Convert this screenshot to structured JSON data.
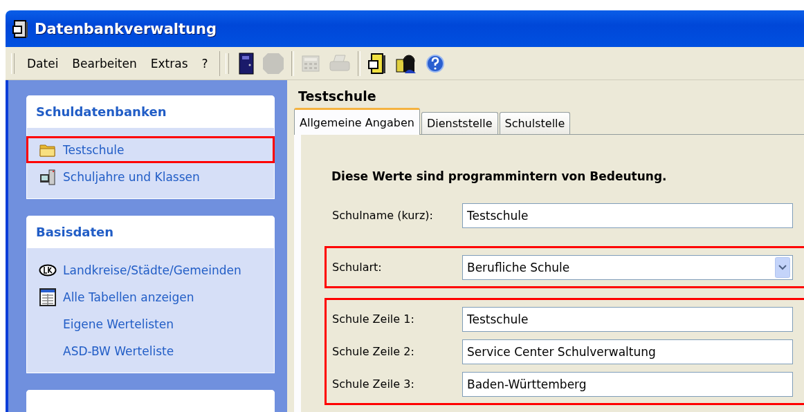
{
  "window": {
    "title": "Datenbankverwaltung"
  },
  "menu": [
    {
      "label": "Datei"
    },
    {
      "label": "Bearbeiten"
    },
    {
      "label": "Extras"
    },
    {
      "label": "?"
    }
  ],
  "toolbar": [
    {
      "kind": "door",
      "disabled": false
    },
    {
      "kind": "stop",
      "disabled": true
    },
    {
      "kind": "sep"
    },
    {
      "kind": "calculator",
      "disabled": true
    },
    {
      "kind": "printer",
      "disabled": true
    },
    {
      "kind": "sep"
    },
    {
      "kind": "cabinet",
      "disabled": false
    },
    {
      "kind": "person",
      "disabled": false
    },
    {
      "kind": "help",
      "disabled": false
    }
  ],
  "sidebar": [
    {
      "title": "Schuldatenbanken",
      "items": [
        {
          "label": "Testschule",
          "kind": "folder",
          "highlighted": true
        },
        {
          "label": "Schuljahre und Klassen",
          "kind": "computer",
          "highlighted": false
        }
      ]
    },
    {
      "title": "Basisdaten",
      "items": [
        {
          "label": "Landkreise/Städte/Gemeinden",
          "kind": "lk",
          "highlighted": false
        },
        {
          "label": "Alle Tabellen anzeigen",
          "kind": "table",
          "highlighted": false
        },
        {
          "label": "Eigene Wertelisten",
          "kind": "plain",
          "highlighted": false
        },
        {
          "label": "ASD-BW Werteliste",
          "kind": "plain",
          "highlighted": false
        }
      ]
    },
    {
      "kind": "empty"
    }
  ],
  "content": {
    "title": "Testschule",
    "tabs": [
      {
        "label": "Allgemeine Angaben",
        "selected": true
      },
      {
        "label": "Dienststelle",
        "selected": false
      },
      {
        "label": "Schulstelle",
        "selected": false
      }
    ],
    "heading": "Diese Werte sind programmintern von Bedeutung.",
    "groups": [
      {
        "highlighted": false,
        "fields": [
          {
            "label": "Schulname (kurz):",
            "value": "Testschule",
            "kind": "text"
          }
        ]
      },
      {
        "highlighted": true,
        "fields": [
          {
            "label": "Schulart:",
            "value": "Berufliche Schule",
            "kind": "select"
          }
        ]
      },
      {
        "highlighted": true,
        "fields": [
          {
            "label": "Schule Zeile 1:",
            "value": "Testschule",
            "kind": "text"
          },
          {
            "label": "Schule Zeile 2:",
            "value": "Service Center Schulverwaltung",
            "kind": "text"
          },
          {
            "label": "Schule Zeile 3:",
            "value": "Baden-Württemberg",
            "kind": "text"
          }
        ]
      }
    ]
  }
}
